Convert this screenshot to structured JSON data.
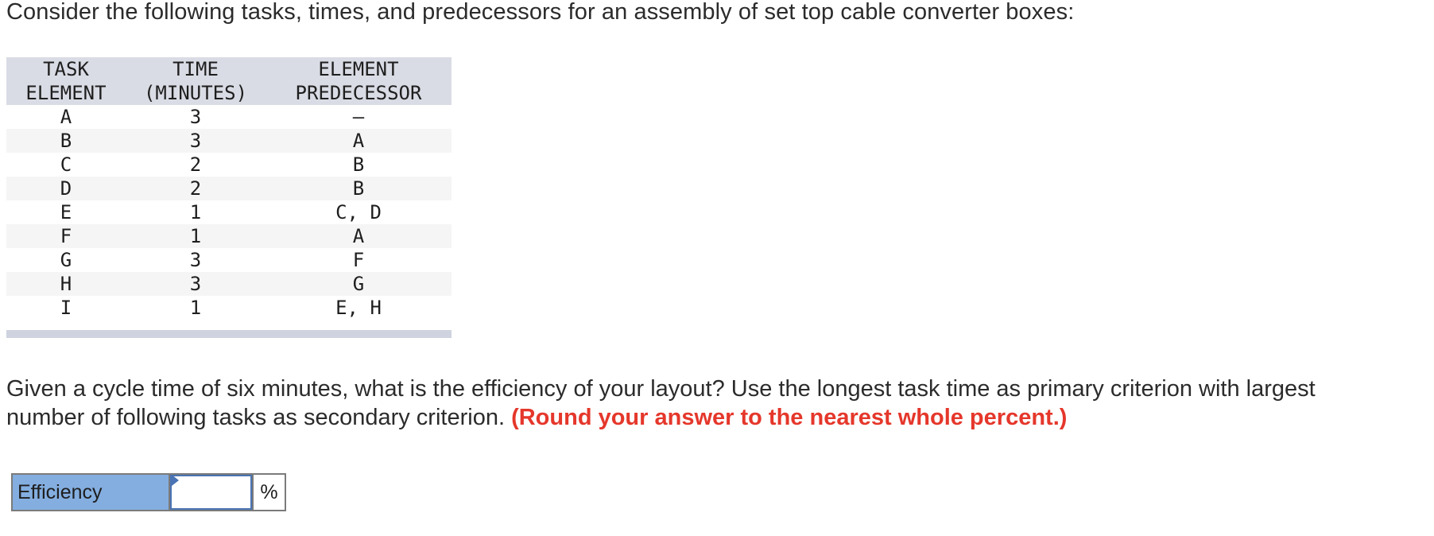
{
  "intro_text": "Consider the following tasks, times, and predecessors for an assembly of set top cable converter boxes:",
  "table": {
    "headers": [
      {
        "line1": "TASK",
        "line2": "ELEMENT"
      },
      {
        "line1": "TIME",
        "line2": "(MINUTES)"
      },
      {
        "line1": "ELEMENT",
        "line2": "PREDECESSOR"
      }
    ],
    "rows": [
      {
        "task": "A",
        "time": "3",
        "predecessor": "—"
      },
      {
        "task": "B",
        "time": "3",
        "predecessor": "A"
      },
      {
        "task": "C",
        "time": "2",
        "predecessor": "B"
      },
      {
        "task": "D",
        "time": "2",
        "predecessor": "B"
      },
      {
        "task": "E",
        "time": "1",
        "predecessor": "C, D"
      },
      {
        "task": "F",
        "time": "1",
        "predecessor": "A"
      },
      {
        "task": "G",
        "time": "3",
        "predecessor": "F"
      },
      {
        "task": "H",
        "time": "3",
        "predecessor": "G"
      },
      {
        "task": "I",
        "time": "1",
        "predecessor": "E, H"
      }
    ]
  },
  "question": {
    "line1": "Given a cycle time of six minutes, what is the efficiency of your layout? Use the longest task time as primary criterion with largest",
    "line2": "number of following tasks as secondary criterion. ",
    "emphasis": "(Round your answer to the nearest whole percent.)"
  },
  "answer": {
    "label": "Efficiency",
    "value": "",
    "unit": "%"
  },
  "colors": {
    "emphasis_red": "#e5372b",
    "label_blue": "#84aee0",
    "input_border": "#4a74b4",
    "table_header": "#d9dce4"
  }
}
